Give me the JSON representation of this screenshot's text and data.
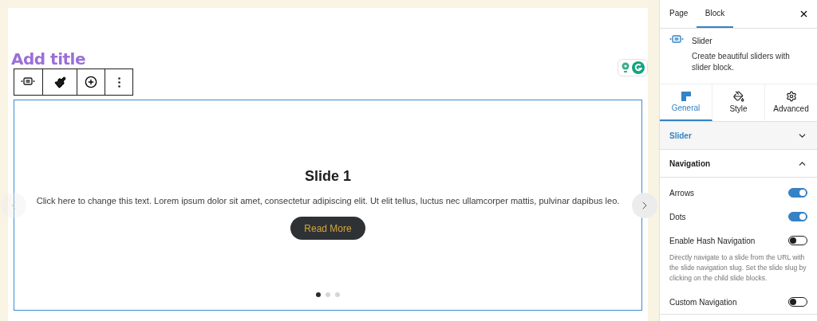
{
  "editor": {
    "title_placeholder": "Add title",
    "toolbar": [
      {
        "kind": "block"
      },
      {
        "kind": "style"
      },
      {
        "kind": "add"
      },
      {
        "kind": "more"
      }
    ]
  },
  "slide": {
    "heading": "Slide 1",
    "text": "Click here to change this text. Lorem ipsum dolor sit amet, consectetur adipiscing elit. Ut elit tellus, luctus nec ullamcorper mattis, pulvinar dapibus leo.",
    "button": "Read More",
    "dots": [
      {
        "selected": true
      },
      {
        "selected": false
      },
      {
        "selected": false
      }
    ]
  },
  "sidebar": {
    "tabs": [
      {
        "label": "Page",
        "selected": false
      },
      {
        "label": "Block",
        "selected": true
      }
    ],
    "block": {
      "name": "Slider",
      "description": "Create beautiful sliders with slider block."
    },
    "setting_tabs": [
      {
        "kind": "general",
        "label": "General",
        "selected": true
      },
      {
        "kind": "style",
        "label": "Style",
        "selected": false
      },
      {
        "kind": "advanced",
        "label": "Advanced",
        "selected": false
      }
    ],
    "panels": [
      {
        "title": "Slider",
        "expanded": false,
        "active": true
      },
      {
        "title": "Navigation",
        "expanded": true,
        "active": false,
        "toggles": [
          {
            "label": "Arrows",
            "on": true
          },
          {
            "label": "Dots",
            "on": true
          },
          {
            "label": "Enable Hash Navigation",
            "on": false,
            "help": "Directly navigate to a slide from the URL with the slide navigation slug. Set the slide slug by clicking on the child slide blocks."
          },
          {
            "label": "Custom Navigation",
            "on": false
          }
        ]
      }
    ]
  }
}
